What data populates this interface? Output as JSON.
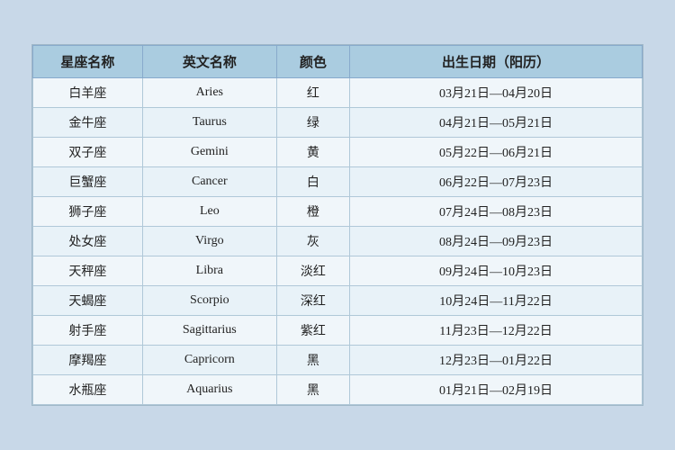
{
  "table": {
    "headers": {
      "chinese_name": "星座名称",
      "english_name": "英文名称",
      "color": "颜色",
      "birthday": "出生日期（阳历）"
    },
    "rows": [
      {
        "chinese": "白羊座",
        "english": "Aries",
        "color": "红",
        "date": "03月21日—04月20日"
      },
      {
        "chinese": "金牛座",
        "english": "Taurus",
        "color": "绿",
        "date": "04月21日—05月21日"
      },
      {
        "chinese": "双子座",
        "english": "Gemini",
        "color": "黄",
        "date": "05月22日—06月21日"
      },
      {
        "chinese": "巨蟹座",
        "english": "Cancer",
        "color": "白",
        "date": "06月22日—07月23日"
      },
      {
        "chinese": "狮子座",
        "english": "Leo",
        "color": "橙",
        "date": "07月24日—08月23日"
      },
      {
        "chinese": "处女座",
        "english": "Virgo",
        "color": "灰",
        "date": "08月24日—09月23日"
      },
      {
        "chinese": "天秤座",
        "english": "Libra",
        "color": "淡红",
        "date": "09月24日—10月23日"
      },
      {
        "chinese": "天蝎座",
        "english": "Scorpio",
        "color": "深红",
        "date": "10月24日—11月22日"
      },
      {
        "chinese": "射手座",
        "english": "Sagittarius",
        "color": "紫红",
        "date": "11月23日—12月22日"
      },
      {
        "chinese": "摩羯座",
        "english": "Capricorn",
        "color": "黑",
        "date": "12月23日—01月22日"
      },
      {
        "chinese": "水瓶座",
        "english": "Aquarius",
        "color": "黑",
        "date": "01月21日—02月19日"
      }
    ]
  }
}
